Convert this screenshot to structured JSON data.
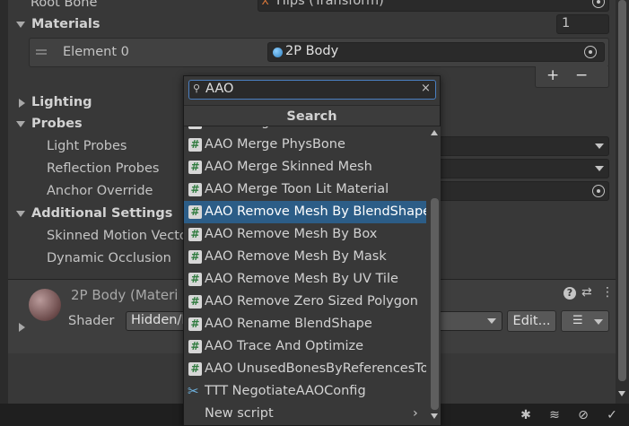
{
  "inspector": {
    "root_bone_label": "Root Bone",
    "root_bone_value": "Hips (Transform)",
    "materials_label": "Materials",
    "materials_count": "1",
    "element0_label": "Element 0",
    "element0_value": "2P Body",
    "plus_label": "+",
    "minus_label": "−",
    "lighting_label": "Lighting",
    "probes_label": "Probes",
    "light_probes_label": "Light Probes",
    "reflection_probes_label": "Reflection Probes",
    "anchor_override_label": "Anchor Override",
    "additional_settings_label": "Additional Settings",
    "skinned_motion_label": "Skinned Motion Vecto",
    "dynamic_occlusion_label": "Dynamic Occlusion",
    "material_name": "2P Body (Materi",
    "shader_label": "Shader",
    "shader_value": "Hidden/I",
    "edit_button_label": "Edit..."
  },
  "popup": {
    "search_value": "AAO",
    "header": "Search",
    "items": [
      {
        "label": "AAO Merge Bone",
        "icon": "script-icon"
      },
      {
        "label": "AAO Merge PhysBone",
        "icon": "script-icon"
      },
      {
        "label": "AAO Merge Skinned Mesh",
        "icon": "script-icon"
      },
      {
        "label": "AAO Merge Toon Lit Material",
        "icon": "script-icon"
      },
      {
        "label": "AAO Remove Mesh By BlendShape",
        "icon": "script-icon",
        "selected": true
      },
      {
        "label": "AAO Remove Mesh By Box",
        "icon": "script-icon"
      },
      {
        "label": "AAO Remove Mesh By Mask",
        "icon": "script-icon"
      },
      {
        "label": "AAO Remove Mesh By UV Tile",
        "icon": "script-icon"
      },
      {
        "label": "AAO Remove Zero Sized Polygon",
        "icon": "script-icon"
      },
      {
        "label": "AAO Rename BlendShape",
        "icon": "script-icon"
      },
      {
        "label": "AAO Trace And Optimize",
        "icon": "script-icon"
      },
      {
        "label": "AAO UnusedBonesByReferencesTool",
        "icon": "script-icon"
      },
      {
        "label": "TTT NegotiateAAOConfig",
        "icon": "tool-icon"
      },
      {
        "label": "New script",
        "icon": "none"
      }
    ]
  },
  "colors": {
    "selection": "#2c5d87",
    "background": "#383838",
    "field": "#2a2a2a",
    "focus_border": "#4a7fc1"
  }
}
